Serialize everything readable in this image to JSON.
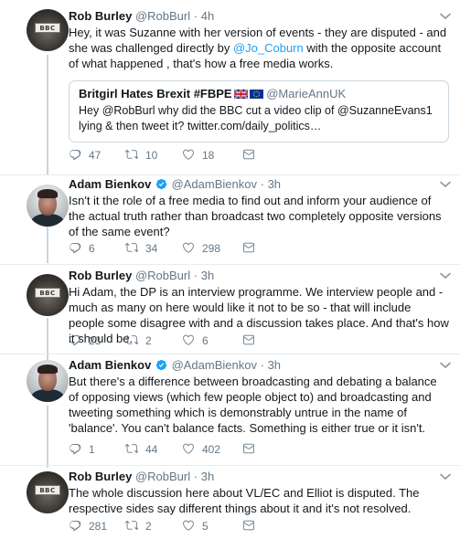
{
  "tweets": [
    {
      "author": "Rob Burley",
      "handle": "@RobBurl",
      "time": "4h",
      "avatar_sign": "BBC",
      "text_parts": [
        "Hey, it was Suzanne with her version of events - they are disputed - and she was challenged directly by ",
        "@Jo_Coburn",
        " with the opposite account of what happened , that's how a free media works."
      ],
      "quote": {
        "name": "Britgirl Hates Brexit #FBPE",
        "handle": "@MarieAnnUK",
        "text": "Hey @RobBurl why did the BBC cut a video clip of @SuzanneEvans1 lying & then tweet it? twitter.com/daily_politics…"
      },
      "replies": "47",
      "retweets": "10",
      "likes": "18"
    },
    {
      "author": "Adam Bienkov",
      "handle": "@AdamBienkov",
      "time": "3h",
      "text": "Isn't it the role of a free media to find out and inform your audience of the actual truth rather than broadcast two completely opposite versions of the same event?",
      "replies": "6",
      "retweets": "34",
      "likes": "298"
    },
    {
      "author": "Rob Burley",
      "handle": "@RobBurl",
      "time": "3h",
      "avatar_sign": "BBC",
      "text": "Hi Adam, the DP is an interview programme. We interview people and - much as many on here would like it not to be so - that will include people some disagree with and a discussion takes place. And that's how it should be.",
      "replies": "23",
      "retweets": "2",
      "likes": "6"
    },
    {
      "author": "Adam Bienkov",
      "handle": "@AdamBienkov",
      "time": "3h",
      "text": "But there's a difference between  broadcasting and debating a balance of opposing views (which few people object to) and broadcasting and tweeting something which is demonstrably untrue in the name of 'balance'. You can't balance facts. Something is either true or it isn't.",
      "replies": "1",
      "retweets": "44",
      "likes": "402"
    },
    {
      "author": "Rob Burley",
      "handle": "@RobBurl",
      "time": "3h",
      "avatar_sign": "BBC",
      "text": "The whole discussion here about VL/EC and Elliot is disputed. The respective sides say different things about it and it's not resolved.",
      "replies": "281",
      "retweets": "2",
      "likes": "5"
    }
  ],
  "separator": "·",
  "icons": {
    "reply": "reply-icon",
    "retweet": "retweet-icon",
    "like": "heart-icon",
    "message": "envelope-icon",
    "verified": "verified-badge-icon",
    "caret": "chevron-down-icon"
  },
  "colors": {
    "link": "#1da1f2",
    "secondary": "#657786",
    "thread_line": "#c4d6e2",
    "border": "#e6ecf0"
  }
}
